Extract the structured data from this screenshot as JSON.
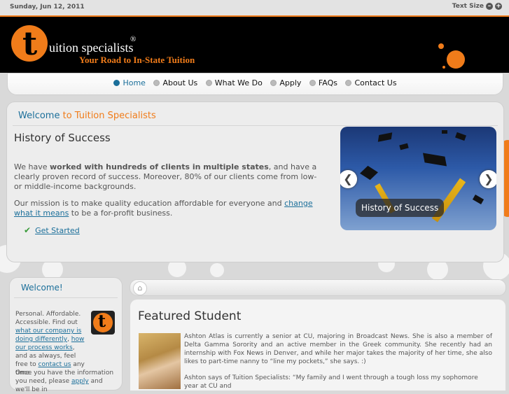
{
  "topbar": {
    "date": "Sunday, Jun 12, 2011",
    "text_size_label": "Text Size",
    "decrease": "–",
    "increase": "+"
  },
  "header": {
    "logo_letter": "t",
    "logo_name": "uition specialists",
    "logo_reg": "®",
    "tagline": "Your Road to In-State Tuition"
  },
  "nav": {
    "items": [
      {
        "label": "Home"
      },
      {
        "label": "About Us"
      },
      {
        "label": "What We Do"
      },
      {
        "label": "Apply"
      },
      {
        "label": "FAQs"
      },
      {
        "label": "Contact Us"
      }
    ]
  },
  "welcome": {
    "title_a": "Welcome",
    "title_b": " to Tuition Specialists",
    "history_title": "History of Success",
    "p1_pre": "We have ",
    "p1_bold": "worked with hundreds of clients in multiple states",
    "p1_post": ", and have a clearly proven record of success. Moreover, 80% of our clients come from low- or middle-income backgrounds.",
    "p2_pre": "Our mission is to make quality education affordable for everyone and ",
    "p2_link": "change what it means",
    "p2_post": " to be a for-profit business.",
    "get_started": "Get Started",
    "slider_caption": "History of Success",
    "prev_arrow": "❮",
    "next_arrow": "❯"
  },
  "sidebar": {
    "title": "Welcome!",
    "logo_letter": "t",
    "text_1": "Personal. Affordable. Accessible. Find out ",
    "link_1": "what our company is doing differently",
    "text_2": ", ",
    "link_2": "how our process works",
    "text_3": ", and as always, feel free to ",
    "link_3": "contact us",
    "text_4": " any time.",
    "text_5": "Once you have the information you need, please ",
    "link_4": "apply",
    "text_6": " and we'll be in"
  },
  "main": {
    "home_icon": "⌂",
    "featured_title": "Featured Student",
    "para_1": "Ashton Atlas is currently a senior at CU, majoring in Broadcast News. She is also a member of Delta Gamma Sorority and an active member in the Greek community. She recently had an internship with Fox News in Denver, and while her major takes the majority of her time, she also likes to part-time nanny to “line my pockets,” she says. :)",
    "para_2": "Ashton says of Tuition Specialists: “My family and I went through a tough loss my sophomore year at CU and"
  },
  "colors": {
    "accent": "#f07c1a",
    "link": "#1b6f9a"
  }
}
